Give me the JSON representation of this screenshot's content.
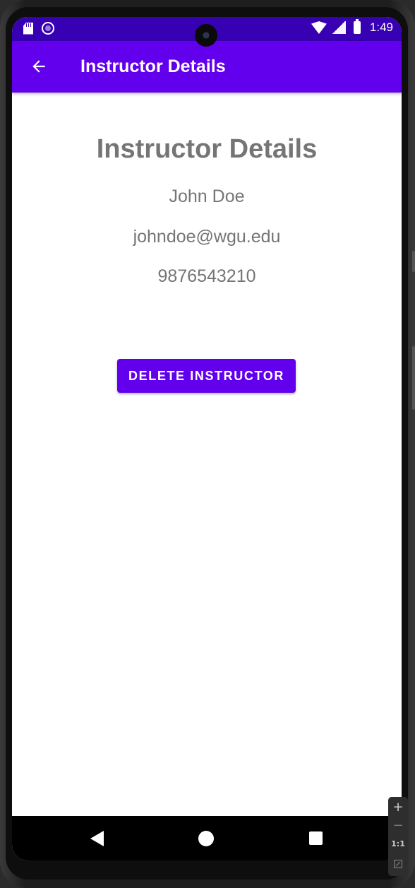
{
  "status_bar": {
    "time": "1:49",
    "icons": [
      "sd-card-icon",
      "media-circle-icon",
      "wifi-icon",
      "signal-icon",
      "battery-icon"
    ]
  },
  "app_bar": {
    "back_icon": "arrow-back-icon",
    "title": "Instructor Details"
  },
  "instructor": {
    "heading": "Instructor Details",
    "name": "John Doe",
    "email": "johndoe@wgu.edu",
    "phone": "9876543210"
  },
  "actions": {
    "delete_label": "DELETE INSTRUCTOR"
  },
  "navigation": {
    "back": "nav-back-icon",
    "home": "nav-home-icon",
    "recents": "nav-recents-icon"
  },
  "emulator_zoom": {
    "zoom_in": "+",
    "zoom_out": "−",
    "actual_size": "1:1"
  },
  "colors": {
    "status_bar": "#3700b3",
    "primary": "#6200ee",
    "text_secondary": "#757575",
    "background": "#ffffff"
  }
}
